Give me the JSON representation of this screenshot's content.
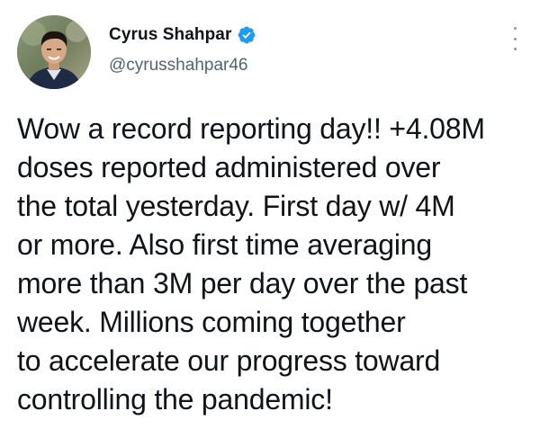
{
  "author": {
    "display_name": "Cyrus Shahpar",
    "handle": "@cyrusshahpar46",
    "verified": true,
    "verified_color": "#1d9bf0"
  },
  "icons": {
    "verified": "verified-badge-icon",
    "more": "more-vertical-icon"
  },
  "tweet": {
    "text_lines": [
      "Wow a record reporting day!! +4.08M",
      "doses reported administered over",
      "the total yesterday. First day w/ 4M",
      "or more. Also first time averaging",
      "more than 3M per day over the past",
      "week. Millions coming together",
      "to accelerate our progress toward",
      "controlling the pandemic!"
    ]
  }
}
